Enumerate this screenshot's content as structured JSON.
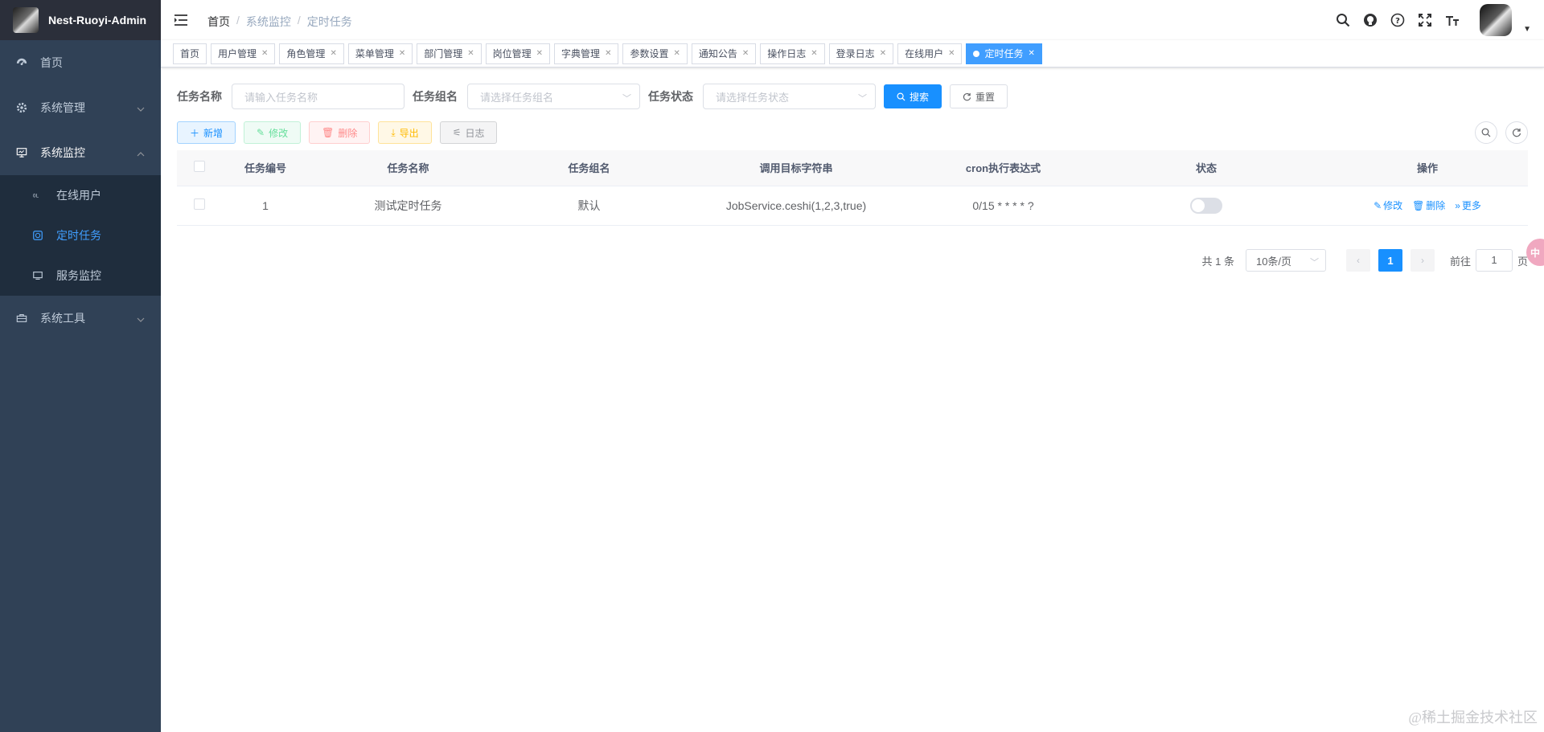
{
  "app": {
    "title": "Nest-Ruoyi-Admin"
  },
  "sidebar": {
    "items": [
      {
        "label": "首页",
        "icon": "dashboard-icon"
      },
      {
        "label": "系统管理",
        "icon": "gear-icon"
      },
      {
        "label": "系统监控",
        "icon": "monitor-icon"
      },
      {
        "label": "系统工具",
        "icon": "toolbox-icon"
      }
    ],
    "submenu": [
      {
        "label": "在线用户",
        "icon": "online-icon"
      },
      {
        "label": "定时任务",
        "icon": "job-icon"
      },
      {
        "label": "服务监控",
        "icon": "server-icon"
      }
    ]
  },
  "breadcrumb": {
    "home": "首页",
    "parent": "系统监控",
    "current": "定时任务",
    "sep": "/"
  },
  "tags": [
    "首页",
    "用户管理",
    "角色管理",
    "菜单管理",
    "部门管理",
    "岗位管理",
    "字典管理",
    "参数设置",
    "通知公告",
    "操作日志",
    "登录日志",
    "在线用户"
  ],
  "active_tag": "定时任务",
  "search": {
    "name_label": "任务名称",
    "name_placeholder": "请输入任务名称",
    "group_label": "任务组名",
    "group_placeholder": "请选择任务组名",
    "status_label": "任务状态",
    "status_placeholder": "请选择任务状态",
    "search_btn": "搜索",
    "reset_btn": "重置"
  },
  "toolbar": {
    "add": "新增",
    "edit": "修改",
    "delete": "删除",
    "export": "导出",
    "log": "日志"
  },
  "table": {
    "headers": [
      "任务编号",
      "任务名称",
      "任务组名",
      "调用目标字符串",
      "cron执行表达式",
      "状态",
      "操作"
    ],
    "rows": [
      {
        "id": "1",
        "name": "测试定时任务",
        "group": "默认",
        "target": "JobService.ceshi(1,2,3,true)",
        "cron": "0/15 * * * * ?",
        "status": false
      }
    ],
    "ops": {
      "edit": "修改",
      "delete": "删除",
      "more": "更多"
    }
  },
  "pagination": {
    "total": "共 1 条",
    "page_size": "10条/页",
    "current": "1",
    "goto_prefix": "前往",
    "goto_value": "1",
    "goto_suffix": "页"
  },
  "colors": {
    "sidebar": "#304156",
    "accent": "#1890ff",
    "active_menu": "#409eff"
  },
  "floating": {
    "label": "中"
  },
  "watermark": "@稀土掘金技术社区"
}
